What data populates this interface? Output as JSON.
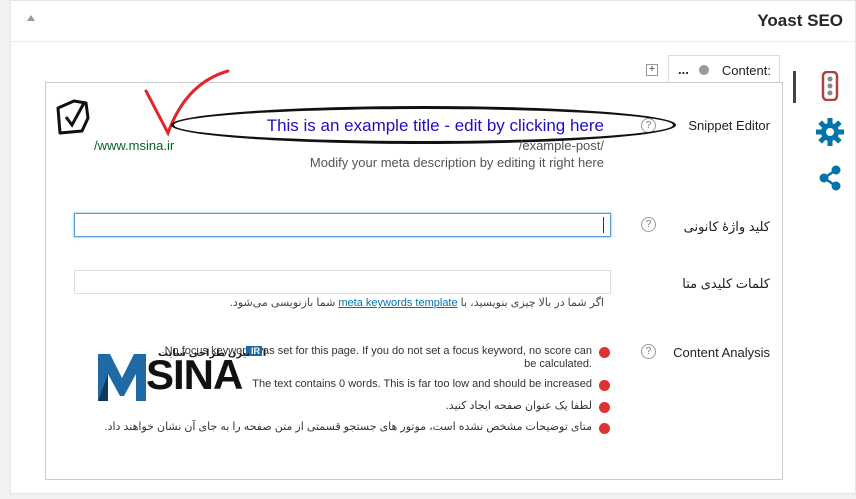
{
  "header": {
    "title": "Yoast SEO"
  },
  "tab": {
    "label": "Content:",
    "dots": "..."
  },
  "plus_label": "+",
  "snippet": {
    "label": "Snippet Editor",
    "title": "This is an example title - edit by clicking here",
    "url": "/www.msina.ir",
    "slug": "/example-post/",
    "description": "Modify your meta description by editing it right here"
  },
  "focus_keyword": {
    "label": "کلید واژهٔ کانونی",
    "value": ""
  },
  "meta_keywords": {
    "label": "کلمات کلیدی متا",
    "hint_before": "اگر شما در بالا چیزی بنویسید، با",
    "hint_link": "meta keywords template",
    "hint_after": "شما بازنویسی می‌شود."
  },
  "content_analysis": {
    "label": "Content Analysis",
    "items": [
      "No focus keyword was set for this page. If you do not set a focus keyword, no score can be calculated.",
      "The text contains 0 words. This is far too low and should be increased",
      "لطفا یک عنوان صفحه ایجاد کنید.",
      "متای توضیحات مشخص نشده است، موتور های جستجو قسمتی از متن صفحه را به جای آن نشان خواهند داد."
    ]
  },
  "logo": {
    "text": "SINA",
    "subtitle": "اکسیژن طراحی سایت",
    "badge": "IR"
  },
  "help_glyph": "?",
  "colors": {
    "title_link": "#1e0fbe",
    "url_green": "#006621",
    "error_red": "#dc3232",
    "icon_blue": "#0073aa"
  }
}
